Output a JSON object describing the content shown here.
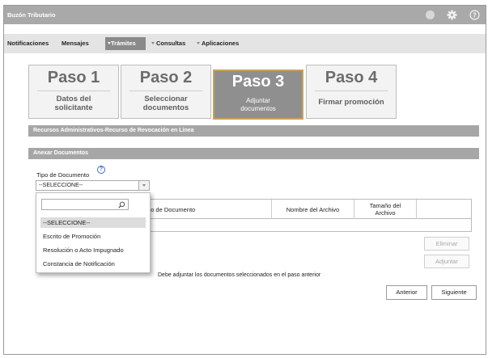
{
  "window": {
    "title": "Buzón Tributario"
  },
  "titlebar_icons": [
    "circle-icon",
    "gear-icon",
    "help-icon"
  ],
  "nav": {
    "notificaciones": "Notificaciones",
    "mensajes": "Mensajes",
    "tramites": "Trámites",
    "consultas": "Consultas",
    "aplicaciones": "Aplicaciones"
  },
  "steps": [
    {
      "num": "Paso 1",
      "line1": "Datos del",
      "line2": "solicitante"
    },
    {
      "num": "Paso 2",
      "line1": "Seleccionar",
      "line2": "documentos"
    },
    {
      "num": "Paso 3",
      "line1": "Adjuntar",
      "line2": "documentos"
    },
    {
      "num": "Paso 4",
      "line1": "Firmar promoción",
      "line2": ""
    }
  ],
  "active_step": 3,
  "section_title": "Recursos Administrativos-Recurso de Revocación en Línea",
  "subsection_title": "Anexar Documentos",
  "tipo_documento": {
    "label": "Tipo de Documento",
    "selected": "--SELECCIONE--",
    "search_placeholder": "",
    "options": [
      "--SELECCIONE--",
      "Escrito de Promoción",
      "Resolución o Acto Impugnado",
      "Constancia de Notificación"
    ]
  },
  "table": {
    "columns": [
      "Tipo de Documento",
      "Nombre del Archivo",
      "Tamaño del Archivo",
      ""
    ],
    "col_visible": [
      "po de Documento",
      "Nombre del Archivo",
      "Tamaño del",
      "Archivo"
    ]
  },
  "buttons": {
    "eliminar": "Eliminar",
    "adjuntar": "Adjuntar",
    "anterior": "Anterior",
    "siguiente": "Siguiente"
  },
  "note": "Debe adjuntar los documentos seleccionados en el paso anterior",
  "colors": {
    "titlebar": "#a9a9a9",
    "active_step_border": "#c8a35c",
    "help_blue": "#3a6fc8"
  }
}
